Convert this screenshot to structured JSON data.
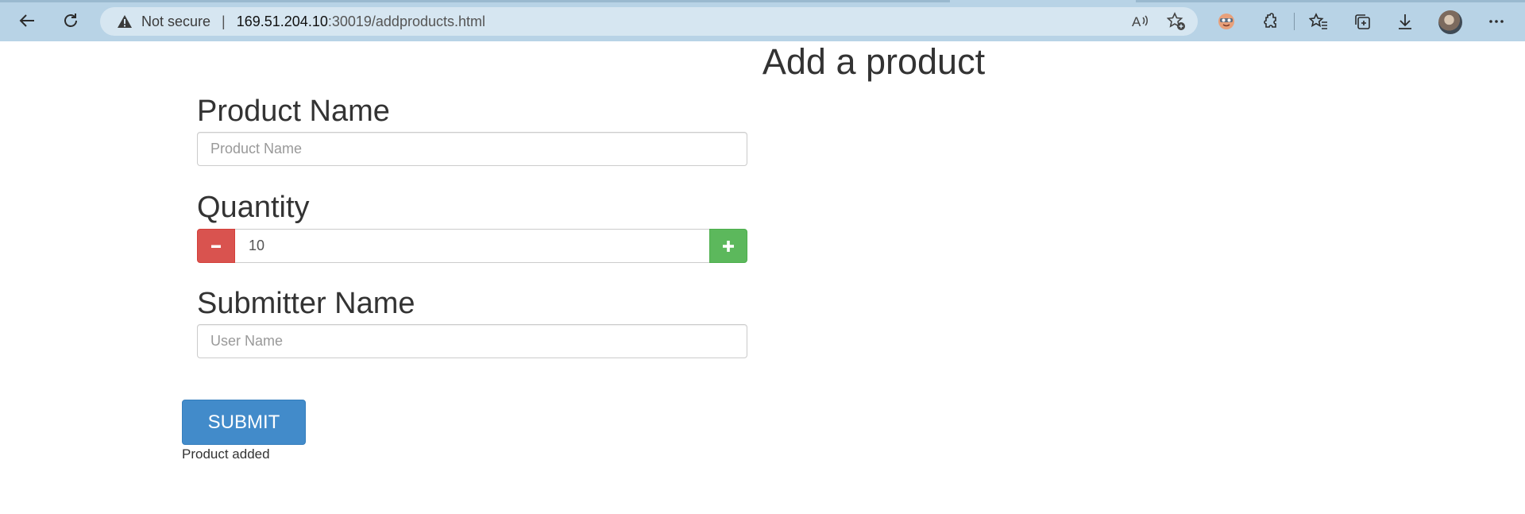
{
  "browser": {
    "security_label": "Not secure",
    "url_host": "169.51.204.10",
    "url_path": ":30019/addproducts.html",
    "icons": [
      "back-icon",
      "refresh-icon",
      "warning-icon",
      "read-aloud-icon",
      "add-favorite-icon",
      "extension-face-icon",
      "extensions-icon",
      "favorites-icon",
      "collections-icon",
      "downloads-icon",
      "profile-avatar",
      "more-menu-icon"
    ]
  },
  "page": {
    "title": "Add a product",
    "product_name": {
      "label": "Product Name",
      "placeholder": "Product Name",
      "value": ""
    },
    "quantity": {
      "label": "Quantity",
      "value": "10",
      "minus_icon": "minus-icon",
      "plus_icon": "plus-icon"
    },
    "submitter_name": {
      "label": "Submitter Name",
      "placeholder": "User Name",
      "value": ""
    },
    "submit_label": "SUBMIT",
    "status_message": "Product added"
  },
  "colors": {
    "chrome": "#b8d3e6",
    "submit": "#428bca",
    "minus": "#d9534f",
    "plus": "#5cb85c"
  }
}
